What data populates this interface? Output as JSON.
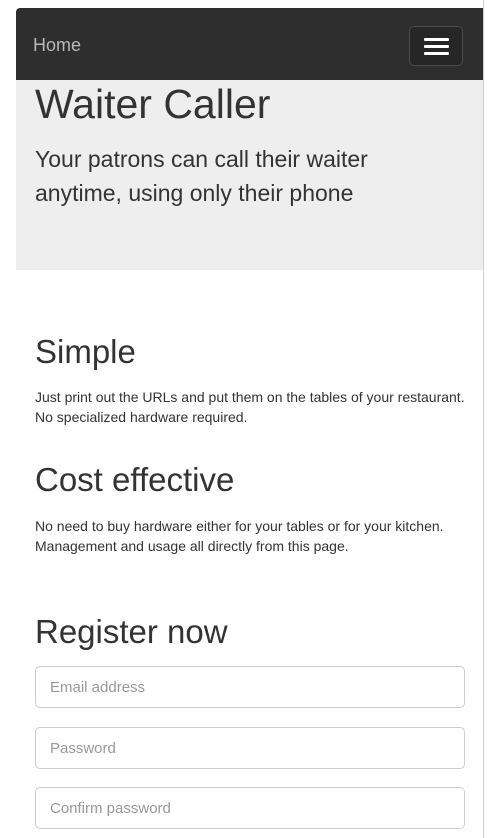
{
  "navbar": {
    "home_label": "Home",
    "menu_toggle_icon": "hamburger-menu-icon"
  },
  "hero": {
    "title": "Waiter Caller",
    "lead": "Your patrons can call their waiter anytime, using only their phone"
  },
  "features": [
    {
      "title": "Simple",
      "text": "Just print out the URLs and put them on the tables of your restaurant. No specialized hardware required."
    },
    {
      "title": "Cost effective",
      "text": "No need to buy hardware either for your tables or for your kitchen. Management and usage all directly from this page."
    }
  ],
  "register": {
    "title": "Register now",
    "email_placeholder": "Email address",
    "password_placeholder": "Password",
    "confirm_placeholder": "Confirm password",
    "email_value": "",
    "password_value": "",
    "confirm_value": ""
  },
  "colors": {
    "navbar_bg": "#2e2e2e",
    "jumbotron_bg": "#eeeeee",
    "text": "#333333"
  }
}
